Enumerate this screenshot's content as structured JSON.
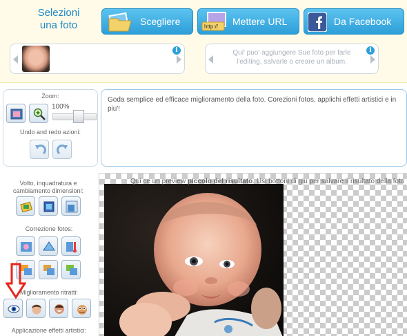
{
  "header": {
    "select_title": "Selezioni\nuna foto",
    "btn_choose": "Scegliere",
    "btn_url": "Mettere URL",
    "btn_url_icon_text": "http://",
    "btn_facebook": "Da Facebook",
    "tip_text": "Qui' puo' aggiungere Sue foto per farle l'editing, salvarle o creare un album.",
    "info_glyph": "i"
  },
  "zoom": {
    "label": "Zoom:",
    "percent": "100%",
    "undo_label": "Undo and redo azioni:"
  },
  "description": "Goda semplice ed efficace miglioramento della foto. Corezioni fotos, applichi effetti artistici e in piu'!",
  "sections": {
    "crop": "Volto, inquadratura e cambiamento dimensioni:",
    "correction": "Correzione fotos:",
    "portrait": "Miglioramento ritratti:",
    "effects": "Applicazione effetti artistici:"
  },
  "preview": {
    "note_pre": "Qui ce un preview ",
    "note_bold": "piccolo del risultato",
    "note_post": ". Usi bottoni di giu per salvare il risultato della foto"
  },
  "colors": {
    "accent": "#2d9fd8",
    "title": "#1e88c8",
    "facebook": "#3b5998",
    "highlight_arrow": "#e8261c"
  },
  "icons": [
    "picture-folder-icon",
    "url-icon",
    "facebook-icon",
    "info-icon",
    "fit-to-screen-icon",
    "zoom-in-icon",
    "undo-icon",
    "redo-icon",
    "rotate-icon",
    "crop-icon",
    "resize-icon",
    "auto-enhance-icon",
    "sharpen-icon",
    "temperature-icon",
    "brightness-icon",
    "contrast-icon",
    "saturation-icon",
    "red-eye-icon",
    "face-icon",
    "teeth-whitening-icon",
    "caricature-icon"
  ]
}
